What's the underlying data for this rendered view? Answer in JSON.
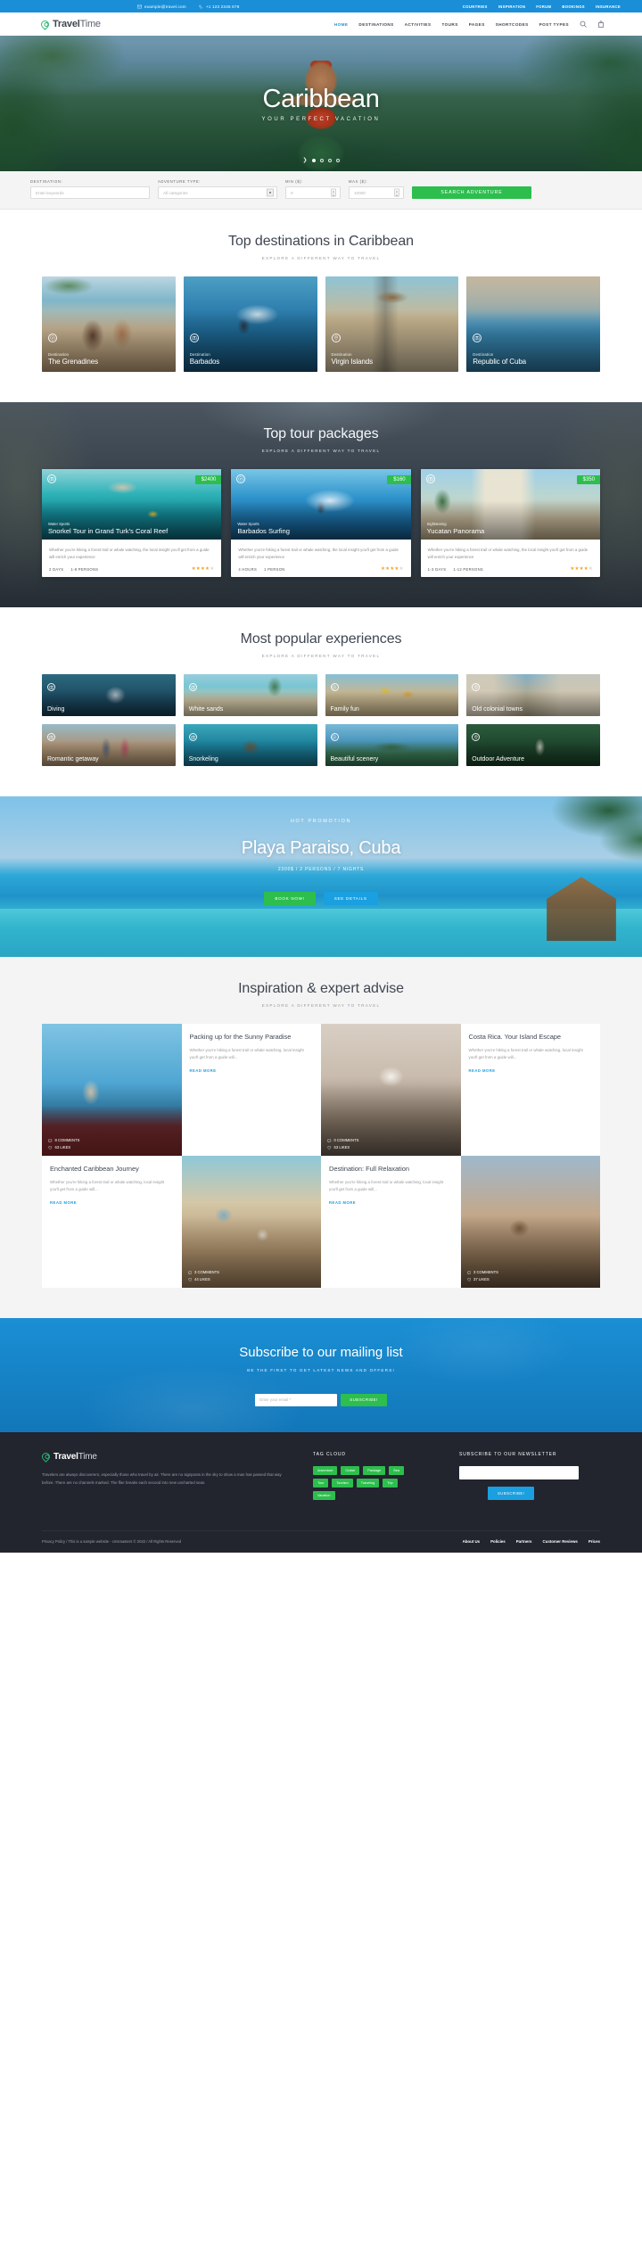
{
  "topbar": {
    "email": "example@travel.com",
    "phone": "+1 123 2345 678",
    "links": [
      "COUNTRIES",
      "INSPIRATION",
      "FORUM",
      "BOOKINGS",
      "INSURANCE"
    ]
  },
  "header": {
    "logo_bold": "Travel",
    "logo_light": "Time",
    "nav": [
      {
        "label": "HOME",
        "active": true
      },
      {
        "label": "DESTINATIONS",
        "active": false
      },
      {
        "label": "ACTIVITIES",
        "active": false
      },
      {
        "label": "TOURS",
        "active": false
      },
      {
        "label": "PAGES",
        "active": false
      },
      {
        "label": "SHORTCODES",
        "active": false
      },
      {
        "label": "POST TYPES",
        "active": false
      }
    ]
  },
  "hero": {
    "title": "Caribbean",
    "subtitle": "YOUR PERFECT VACATION",
    "slide_count": 4,
    "active_slide": 1
  },
  "search": {
    "destination_label": "DESTINATION:",
    "destination_placeholder": "Enter keywords",
    "type_label": "ADVENTURE TYPE:",
    "type_value": "All categories",
    "min_label": "MIN ($):",
    "min_value": "0",
    "max_label": "MAX ($):",
    "max_value": "10000",
    "button": "SEARCH ADVENTURE"
  },
  "destinations": {
    "title": "Top destinations in Caribbean",
    "subtitle": "EXPLORE A DIFFERENT WAY TO TRAVEL",
    "kicker": "Destination",
    "items": [
      {
        "name": "The Grenadines",
        "icon": "compass-icon",
        "img": "img-grenadines"
      },
      {
        "name": "Barbados",
        "icon": "camera-icon",
        "img": "img-barbados"
      },
      {
        "name": "Virgin Islands",
        "icon": "pin-icon",
        "img": "img-virgin"
      },
      {
        "name": "Republic of Cuba",
        "icon": "camera-icon",
        "img": "img-cuba"
      }
    ]
  },
  "tours": {
    "title": "Top tour packages",
    "subtitle": "EXPLORE A DIFFERENT WAY TO TRAVEL",
    "description": "Whether you're hiking a forest trail or whale watching, the local insight you'll get from a guide will enrich your experience",
    "items": [
      {
        "price": "$2400",
        "category": "Water Sports",
        "icon": "camera-icon",
        "name": "Snorkel Tour in Grand Turk's Coral Reef",
        "duration": "2 DAYS",
        "persons": "1-8 PERSONS",
        "rating": 4.5,
        "img": "img-snorkel"
      },
      {
        "price": "$160",
        "category": "Water Sports",
        "icon": "compass-icon",
        "name": "Barbados Surfing",
        "duration": "4 HOURS",
        "persons": "1 PERSON",
        "rating": 4,
        "img": "img-surf"
      },
      {
        "price": "$350",
        "category": "Sightseeing",
        "icon": "camera-icon",
        "name": "Yucatan Panorama",
        "duration": "1-3 DAYS",
        "persons": "1-12 PERSONS",
        "rating": 4.5,
        "img": "img-yucatan"
      }
    ]
  },
  "experiences": {
    "title": "Most popular experiences",
    "subtitle": "EXPLORE A DIFFERENT WAY TO TRAVEL",
    "items": [
      {
        "name": "Diving",
        "icon": "camera-icon",
        "img": "img-diving"
      },
      {
        "name": "White sands",
        "icon": "camera-icon",
        "img": "img-whitesands"
      },
      {
        "name": "Family fun",
        "icon": "compass-icon",
        "img": "img-family"
      },
      {
        "name": "Old colonial towns",
        "icon": "pin-icon",
        "img": "img-colonial"
      },
      {
        "name": "Romantic getaway",
        "icon": "camera-icon",
        "img": "img-romantic"
      },
      {
        "name": "Snorkeling",
        "icon": "camera-icon",
        "img": "img-snorkeling"
      },
      {
        "name": "Beautiful scenery",
        "icon": "compass-icon",
        "img": "img-scenery"
      },
      {
        "name": "Outdoor Adventure",
        "icon": "pin-icon",
        "img": "img-outdoor"
      }
    ]
  },
  "promo": {
    "kicker": "HOT PROMOTION",
    "title": "Playa Paraiso, Cuba",
    "meta": "2300$ / 2 PERSONS / 7 NIGHTS",
    "book_label": "BOOK NOW!",
    "details_label": "SEE DETAILS"
  },
  "blog": {
    "title": "Inspiration & expert advise",
    "subtitle": "EXPLORE A DIFFERENT WAY TO TRAVEL",
    "excerpt": "Whether you're hiking a forest trail or whale watching, local insight you'll get from a guide will...",
    "read_more": "READ MORE",
    "posts": [
      {
        "title": "Packing up for the Sunny Paradise",
        "comments": "8 COMMENTS",
        "likes": "63 LIKES",
        "img": "img-convertible"
      },
      {
        "title": "Costa Rica. Your Island Escape",
        "comments": "0 COMMENTS",
        "likes": "53 LIKES",
        "img": "img-plane"
      },
      {
        "title": "Enchanted Caribbean Journey",
        "comments": "3 COMMENTS",
        "likes": "44 LIKES",
        "img": "img-picnic"
      },
      {
        "title": "Destination: Full Relaxation",
        "comments": "3 COMMENTS",
        "likes": "37 LIKES",
        "img": "img-luggage"
      }
    ]
  },
  "subscribe": {
    "title": "Subscribe to our mailing list",
    "subtitle": "BE THE FIRST TO GET LATEST NEWS AND OFFERS!",
    "placeholder": "Enter your email *",
    "button": "SUBSCRIBE!"
  },
  "footer": {
    "logo_bold": "Travel",
    "logo_light": "Time",
    "about": "Travelers are always discoverers, especially those who travel by air. There are no signposts in the sky to show a man has passed that way before. There are no channels marked. The flier breaks each second into new uncharted seas.",
    "tag_heading": "TAG CLOUD",
    "tags": [
      "Adventure",
      "Cruise",
      "Package",
      "Sea",
      "Tour",
      "Tourism",
      "Traveling",
      "Trip",
      "Vacation"
    ],
    "newsletter_heading": "SUBSCRIBE TO OUR NEWSLETTER",
    "newsletter_button": "SUBSCRIBE!",
    "copyright": "Privacy Policy /  This is a sample website - cmsmasters © 2022 / All Rights Reserved",
    "links": [
      "About Us",
      "Policies",
      "Partners",
      "Customer Reviews",
      "Prices"
    ]
  },
  "colors": {
    "brand_blue": "#1a8fd8",
    "accent_green": "#2dbe4e",
    "link_blue": "#1a9fe0",
    "star_gold": "#f5a623",
    "dark": "#22242e"
  }
}
